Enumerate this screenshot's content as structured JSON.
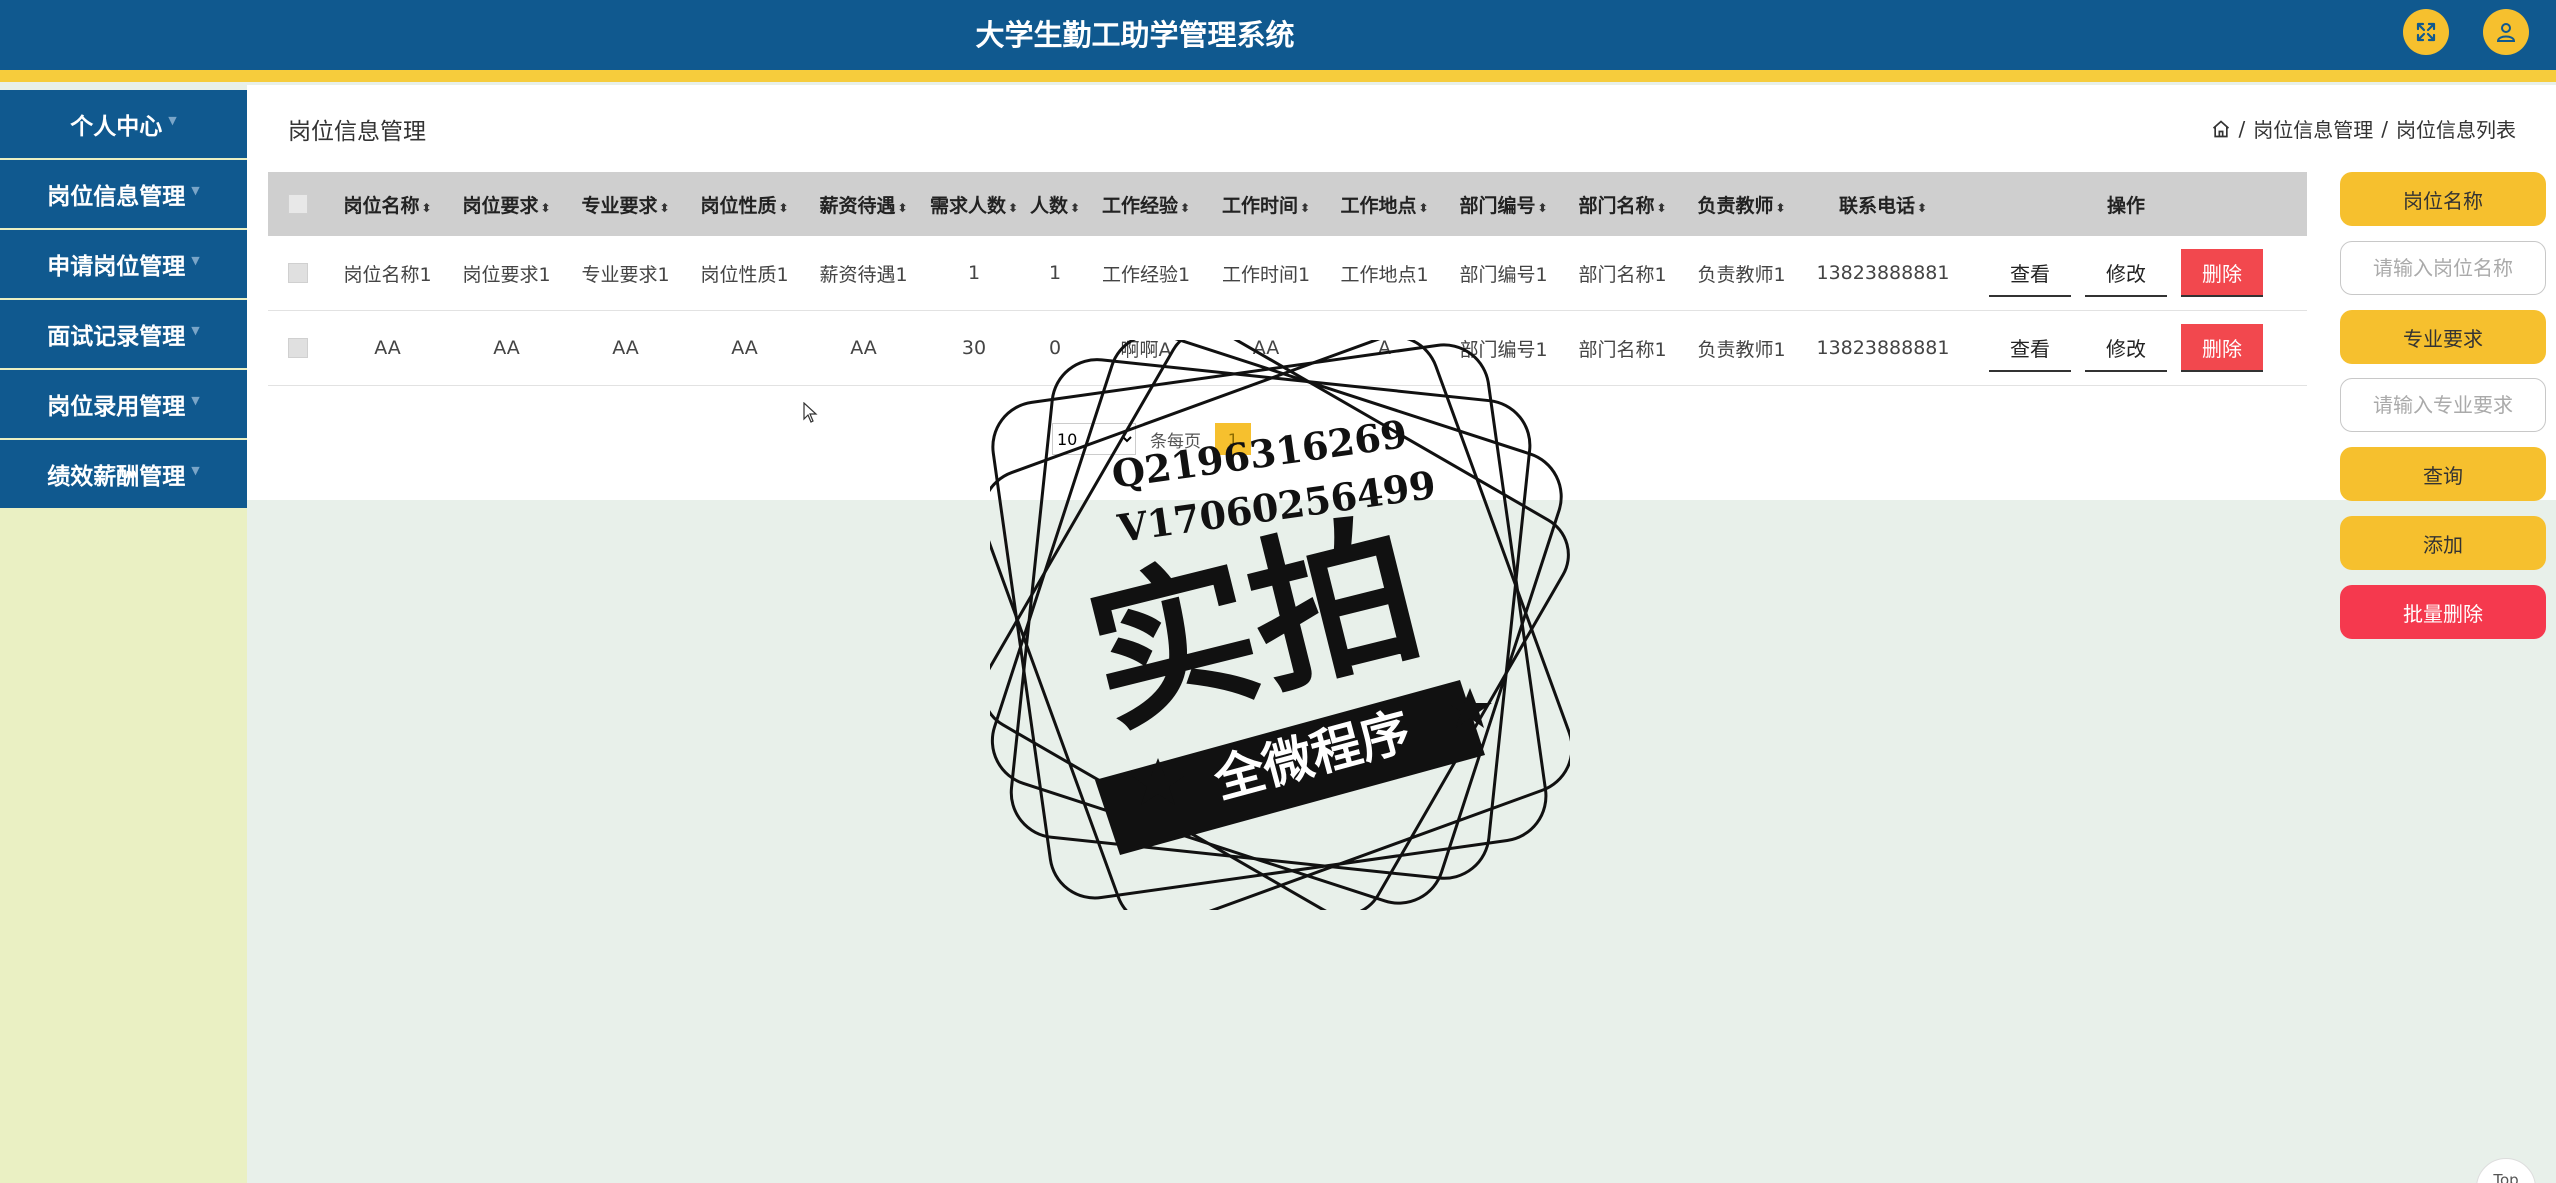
{
  "header": {
    "title": "大学生勤工助学管理系统",
    "fullscreen_icon": "fullscreen-icon",
    "user_icon": "user-icon",
    "colors": {
      "primary": "#10598f",
      "accent": "#f6cc3c"
    }
  },
  "sidebar": {
    "items": [
      {
        "label": "个人中心"
      },
      {
        "label": "岗位信息管理"
      },
      {
        "label": "申请岗位管理"
      },
      {
        "label": "面试记录管理"
      },
      {
        "label": "岗位录用管理"
      },
      {
        "label": "绩效薪酬管理"
      }
    ]
  },
  "page": {
    "heading": "岗位信息管理",
    "breadcrumb": {
      "home_icon": "home-icon",
      "sep": "/",
      "level1": "岗位信息管理",
      "level2": "岗位信息列表"
    }
  },
  "table": {
    "headers": [
      "岗位名称",
      "岗位要求",
      "专业要求",
      "岗位性质",
      "薪资待遇",
      "需求人数",
      "人数",
      "工作经验",
      "工作时间",
      "工作地点",
      "部门编号",
      "部门名称",
      "负责教师",
      "联系电话"
    ],
    "ops_header": "操作",
    "rows": [
      {
        "cells": [
          "岗位名称1",
          "岗位要求1",
          "专业要求1",
          "岗位性质1",
          "薪资待遇1",
          "1",
          "1",
          "工作经验1",
          "工作时间1",
          "工作地点1",
          "部门编号1",
          "部门名称1",
          "负责教师1",
          "13823888881"
        ]
      },
      {
        "cells": [
          "AA",
          "AA",
          "AA",
          "AA",
          "AA",
          "30",
          "0",
          "啊啊A",
          "AA",
          "A",
          "部门编号1",
          "部门名称1",
          "负责教师1",
          "13823888881"
        ]
      }
    ],
    "actions": {
      "view": "查看",
      "edit": "修改",
      "delete": "删除"
    }
  },
  "pager": {
    "page_size": "10",
    "per_page_label": "条每页",
    "current_page": "1"
  },
  "right_panel": {
    "name_label": "岗位名称",
    "name_placeholder": "请输入岗位名称",
    "major_label": "专业要求",
    "major_placeholder": "请输入专业要求",
    "search": "查询",
    "add": "添加",
    "batch_delete": "批量删除"
  },
  "watermark": {
    "line1": "Q2196316269",
    "line2": "V17060256499",
    "main": "实拍",
    "ribbon": "全微程序"
  },
  "top_button": "Top"
}
